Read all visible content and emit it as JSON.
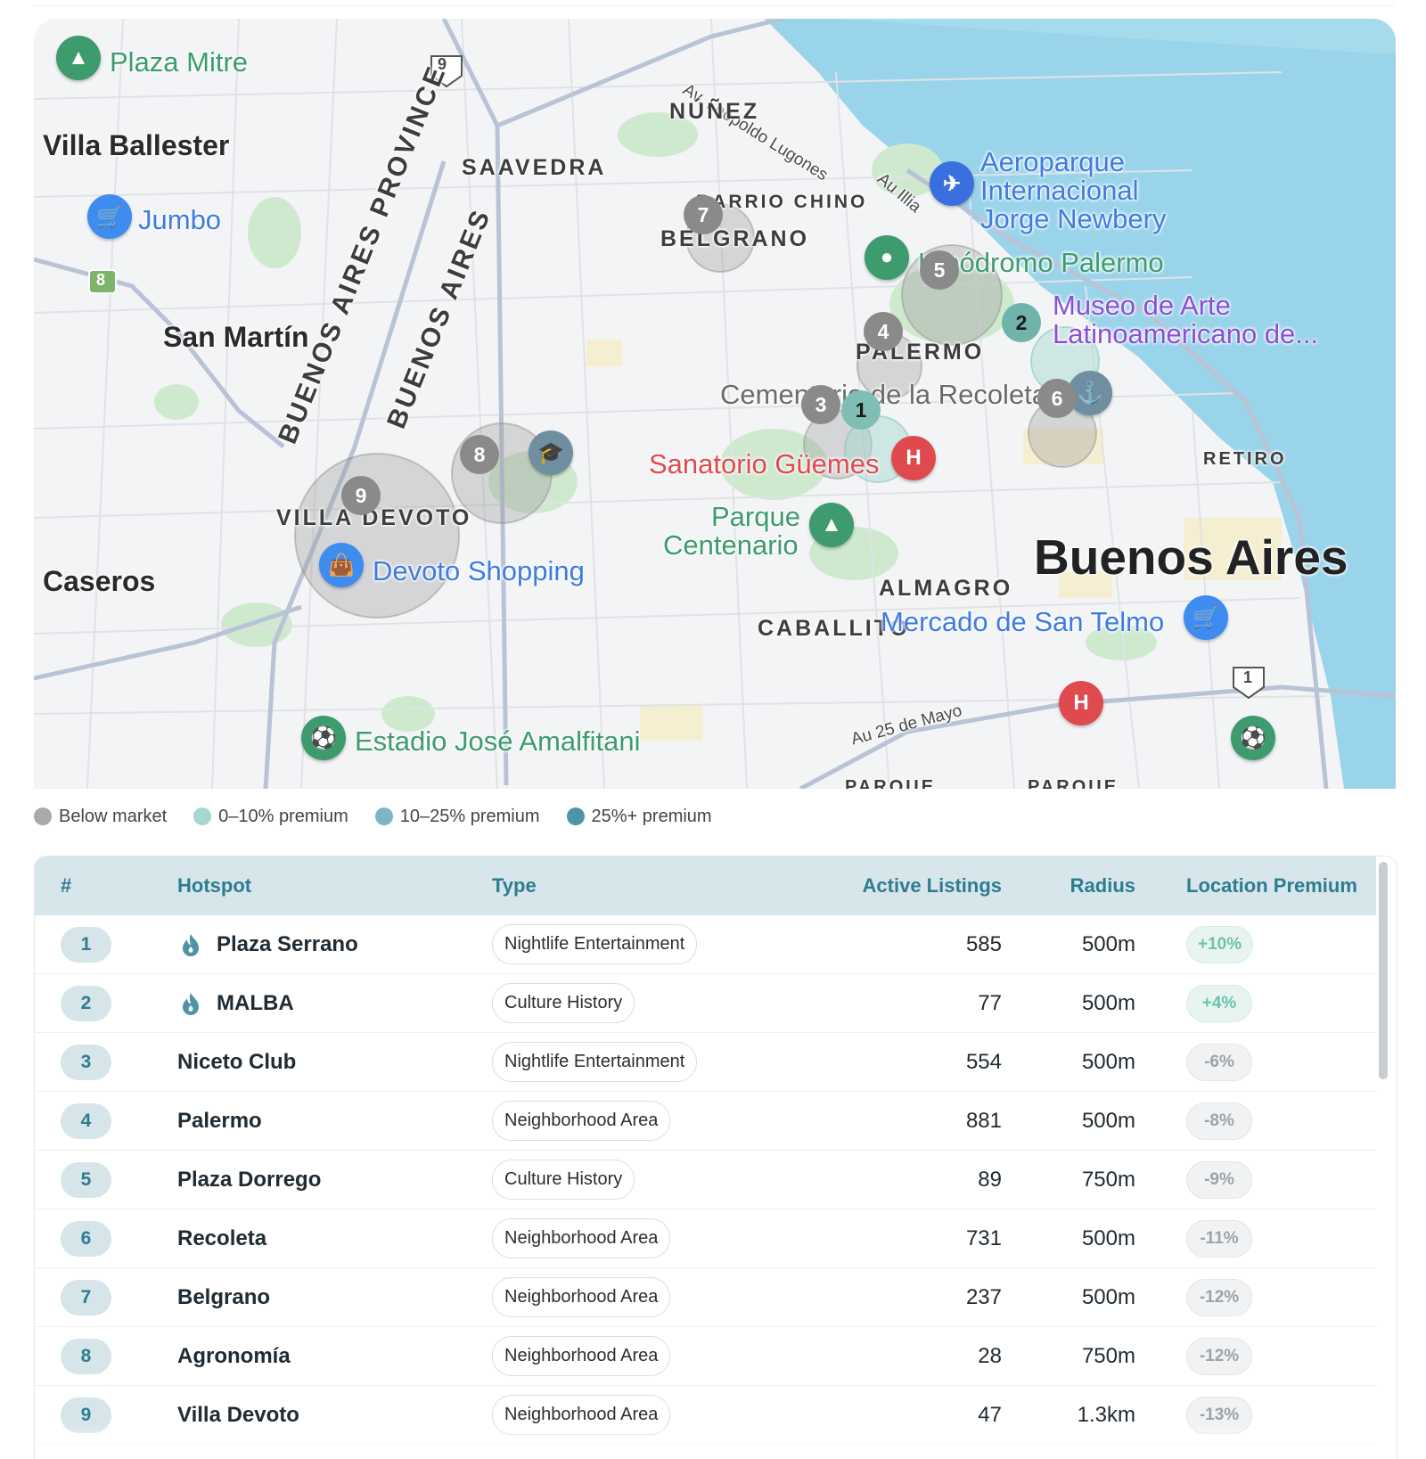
{
  "map": {
    "places": {
      "villa_ballester": "Villa Ballester",
      "san_martin": "San Martín",
      "caseros": "Caseros",
      "nunez": "NÚÑEZ",
      "saavedra": "SAAVEDRA",
      "barrio_chino": "BARRIO CHINO",
      "belgrano": "BELGRANO",
      "palermo": "PALERMO",
      "villa_devoto": "VILLA DEVOTO",
      "almagro": "ALMAGRO",
      "caballito": "CABALLITO",
      "retiro": "RETIRO",
      "parque_left": "PARQUE",
      "parque_right": "PARQUE",
      "buenos_aires_city": "Buenos Aires",
      "province_1": "BUENOS AIRES PROVINCE",
      "province_2": "BUENOS AIRES"
    },
    "pois": {
      "plaza_mitre": "Plaza Mitre",
      "jumbo": "Jumbo",
      "aeroparque": "Aeroparque",
      "aeroparque_2": "Internacional",
      "aeroparque_3": "Jorge Newbery",
      "hipodromo": "Hipódromo Palermo",
      "museo_1": "Museo de Arte",
      "museo_2": "Latinoamericano de...",
      "cementerio": "Cementerio de la Recoleta",
      "sanatorio": "Sanatorio Güemes",
      "parque_centenario_1": "Parque",
      "parque_centenario_2": "Centenario",
      "devoto_shopping": "Devoto Shopping",
      "mercado": "Mercado de San Telmo",
      "estadio": "Estadio José Amalfitani"
    },
    "roads": {
      "lugones": "Av. Leopoldo Lugones",
      "illia": "Au Illia",
      "au25": "Au 25 de Mayo",
      "route_9": "9",
      "route_8": "8",
      "route_1": "1"
    },
    "markers": [
      {
        "rank": "1",
        "tier": "0-10"
      },
      {
        "rank": "2",
        "tier": "0-10"
      },
      {
        "rank": "3",
        "tier": "below"
      },
      {
        "rank": "4",
        "tier": "below"
      },
      {
        "rank": "5",
        "tier": "below"
      },
      {
        "rank": "6",
        "tier": "below"
      },
      {
        "rank": "7",
        "tier": "below"
      },
      {
        "rank": "8",
        "tier": "below"
      },
      {
        "rank": "9",
        "tier": "below"
      }
    ]
  },
  "legend": [
    {
      "label": "Below market",
      "color": "#a9a9a9"
    },
    {
      "label": "0–10% premium",
      "color": "#a4d8cf"
    },
    {
      "label": "10–25% premium",
      "color": "#7ab7c5"
    },
    {
      "label": "25%+ premium",
      "color": "#4f93a6"
    }
  ],
  "table": {
    "headers": {
      "rank": "#",
      "hotspot": "Hotspot",
      "type": "Type",
      "listings": "Active Listings",
      "radius": "Radius",
      "premium": "Location Premium"
    },
    "rows": [
      {
        "rank": "1",
        "name": "Plaza Serrano",
        "hot": true,
        "type": "Nightlife Entertainment",
        "listings": "585",
        "radius": "500m",
        "premium": "+10%"
      },
      {
        "rank": "2",
        "name": "MALBA",
        "hot": true,
        "type": "Culture History",
        "listings": "77",
        "radius": "500m",
        "premium": "+4%"
      },
      {
        "rank": "3",
        "name": "Niceto Club",
        "hot": false,
        "type": "Nightlife Entertainment",
        "listings": "554",
        "radius": "500m",
        "premium": "-6%"
      },
      {
        "rank": "4",
        "name": "Palermo",
        "hot": false,
        "type": "Neighborhood Area",
        "listings": "881",
        "radius": "500m",
        "premium": "-8%"
      },
      {
        "rank": "5",
        "name": "Plaza Dorrego",
        "hot": false,
        "type": "Culture History",
        "listings": "89",
        "radius": "750m",
        "premium": "-9%"
      },
      {
        "rank": "6",
        "name": "Recoleta",
        "hot": false,
        "type": "Neighborhood Area",
        "listings": "731",
        "radius": "500m",
        "premium": "-11%"
      },
      {
        "rank": "7",
        "name": "Belgrano",
        "hot": false,
        "type": "Neighborhood Area",
        "listings": "237",
        "radius": "500m",
        "premium": "-12%"
      },
      {
        "rank": "8",
        "name": "Agronomía",
        "hot": false,
        "type": "Neighborhood Area",
        "listings": "28",
        "radius": "750m",
        "premium": "-12%"
      },
      {
        "rank": "9",
        "name": "Villa Devoto",
        "hot": false,
        "type": "Neighborhood Area",
        "listings": "47",
        "radius": "1.3km",
        "premium": "-13%"
      }
    ]
  }
}
